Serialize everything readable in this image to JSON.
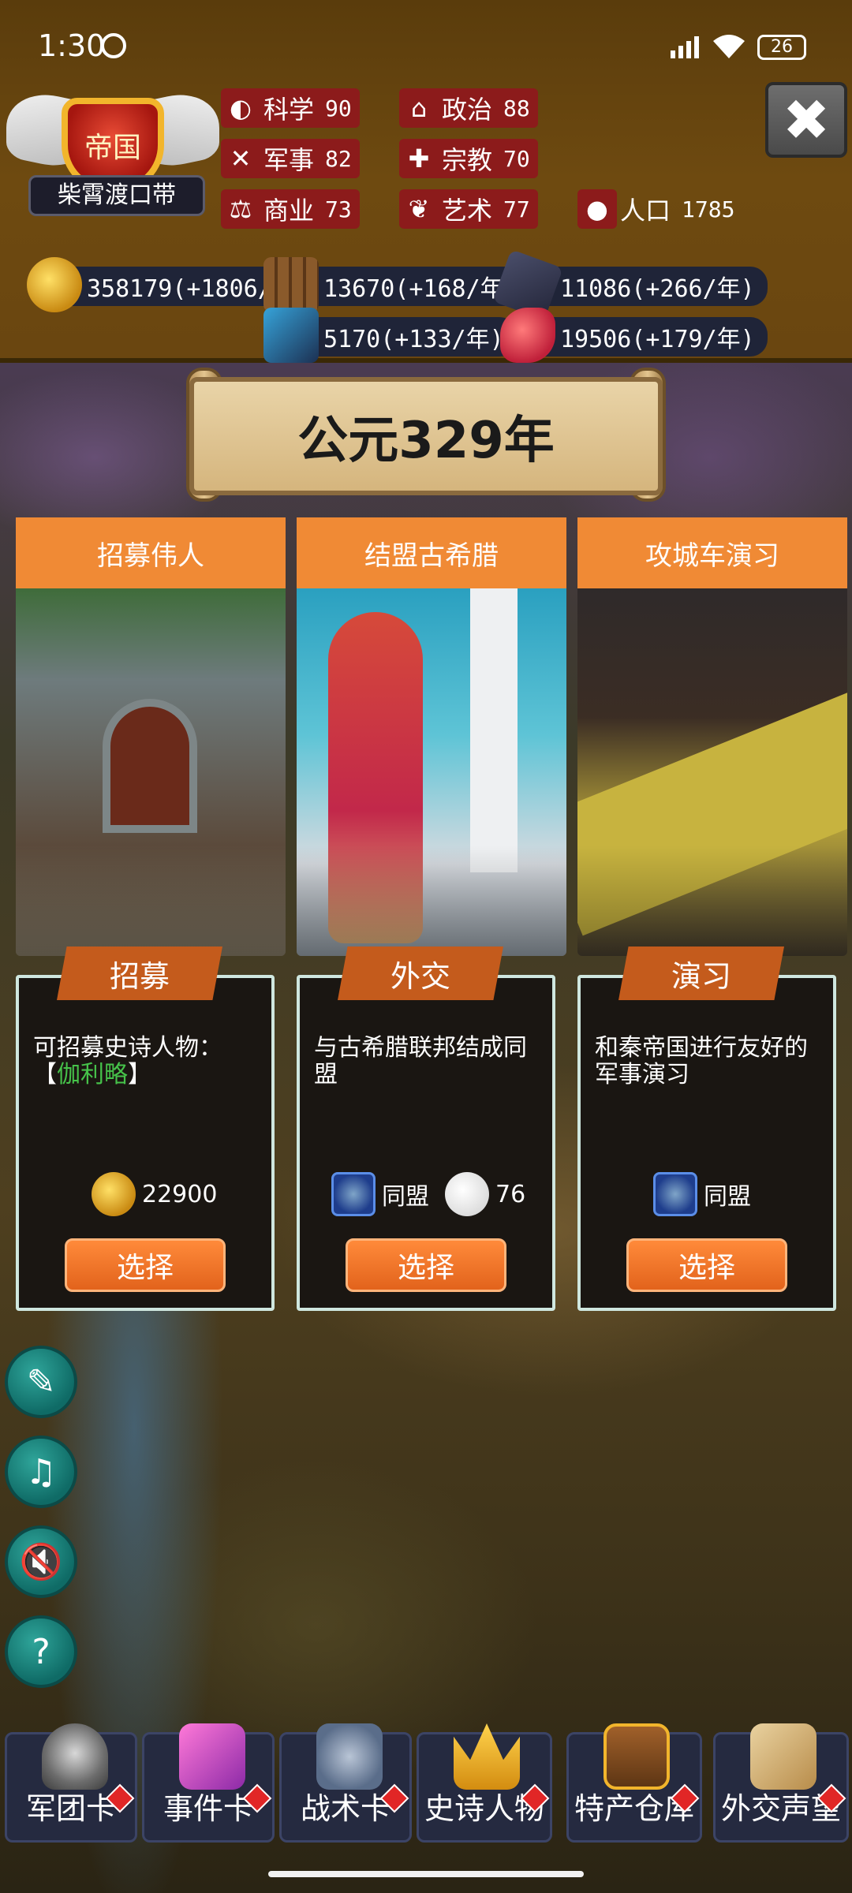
{
  "status_bar": {
    "time": "1:30",
    "battery": "26"
  },
  "emblem": {
    "title": "帝国",
    "name": "柴霄渡口带"
  },
  "stats": {
    "science": {
      "label": "科学",
      "value": "90"
    },
    "politics": {
      "label": "政治",
      "value": "88"
    },
    "military": {
      "label": "军事",
      "value": "82"
    },
    "religion": {
      "label": "宗教",
      "value": "70"
    },
    "commerce": {
      "label": "商业",
      "value": "73"
    },
    "art": {
      "label": "艺术",
      "value": "77"
    },
    "population": {
      "label": "人口",
      "value": "1785"
    }
  },
  "resources": {
    "gold": "358179(+1806/年)",
    "wood": "13670(+168/年)",
    "stone": "11086(+266/年)",
    "ore": "5170(+133/年)",
    "food": "19506(+179/年)"
  },
  "year_banner": "公元329年",
  "cards": [
    {
      "title": "招募伟人",
      "tag": "招募",
      "desc_prefix": "可招募史诗人物：",
      "desc_open": "【",
      "desc_highlight": "伽利略",
      "desc_close": "】",
      "cost_value": "22900",
      "button": "选择"
    },
    {
      "title": "结盟古希腊",
      "tag": "外交",
      "desc": "与古希腊联邦结成同盟",
      "effect_label": "同盟",
      "effect_value": "76",
      "button": "选择"
    },
    {
      "title": "攻城车演习",
      "tag": "演习",
      "desc": "和秦帝国进行友好的军事演习",
      "effect_label": "同盟",
      "button": "选择"
    }
  ],
  "bottom_nav": [
    {
      "label": "军团卡"
    },
    {
      "label": "事件卡"
    },
    {
      "label": "战术卡"
    },
    {
      "label": "史诗人物"
    },
    {
      "label": "特产仓库"
    },
    {
      "label": "外交声望"
    }
  ]
}
